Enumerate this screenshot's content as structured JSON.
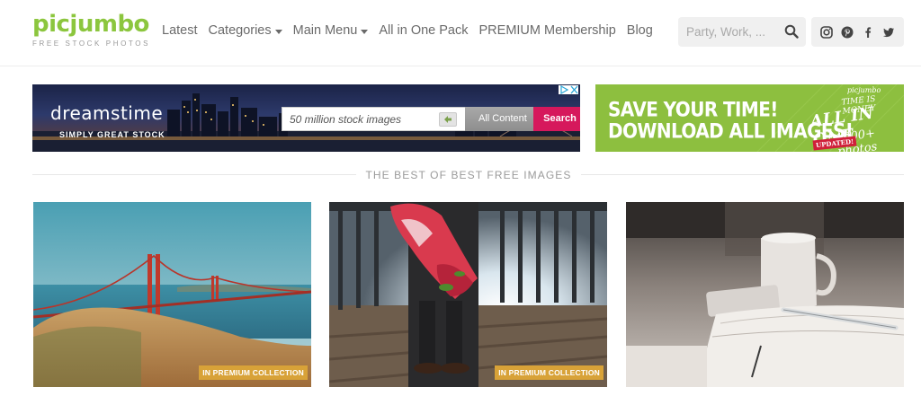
{
  "logo": {
    "title": "picjumbo",
    "subtitle": "FREE STOCK PHOTOS"
  },
  "nav": {
    "latest": "Latest",
    "categories": "Categories",
    "main_menu": "Main Menu",
    "all_in_one": "All in One Pack",
    "premium": "PREMIUM Membership",
    "blog": "Blog"
  },
  "search": {
    "placeholder": "Party, Work, ..."
  },
  "social": [
    "instagram-icon",
    "pinterest-icon",
    "facebook-icon",
    "twitter-icon"
  ],
  "ad_dreamstime": {
    "brand": "dreamstime",
    "tagline": "SIMPLY GREAT STOCK",
    "placeholder": "50 million stock images",
    "dropdown": "All Content",
    "button": "Search"
  },
  "ad_picjumbo": {
    "line1": "SAVE YOUR TIME!",
    "line2": "DOWNLOAD ALL IMAGES!",
    "stamp_brand": "picjumbo",
    "stamp_motto": "TIME IS MONEY",
    "stamp_title": "ALL IN ONE",
    "stamp_count": "1000+ photos",
    "stamp_badge": "UPDATED!"
  },
  "section": {
    "title": "THE BEST OF BEST FREE IMAGES"
  },
  "cards": [
    {
      "subject": "golden-gate-bridge-photo",
      "badge": "IN PREMIUM COLLECTION"
    },
    {
      "subject": "flowers-bouquet-photo",
      "badge": "IN PREMIUM COLLECTION"
    },
    {
      "subject": "desk-notebook-photo",
      "badge": ""
    }
  ],
  "colors": {
    "brand_green": "#8cc63e",
    "premium_badge": "#d8a238",
    "ad_search": "#d6185c"
  }
}
